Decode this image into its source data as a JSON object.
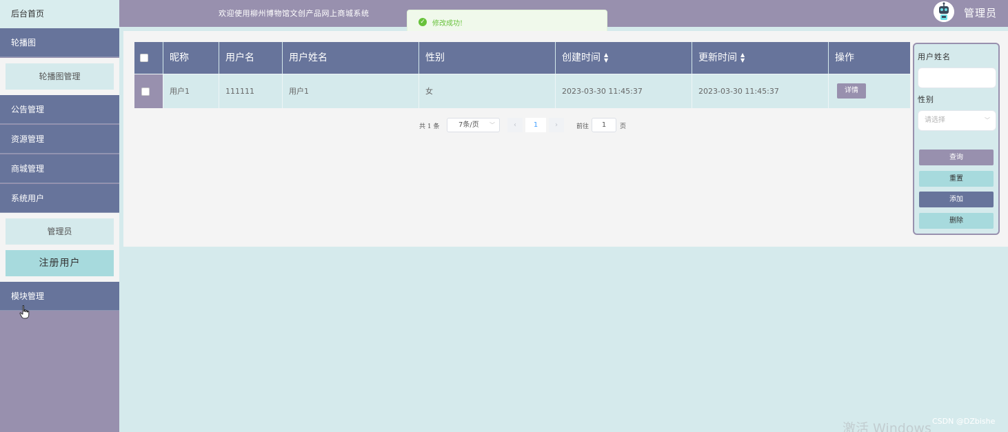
{
  "header": {
    "welcome": "欢迎使用柳州博物馆文创产品网上商城系统",
    "user_label": "管理员"
  },
  "toast": {
    "message": "修改成功!"
  },
  "sidebar": {
    "home": "后台首页",
    "carousel": "轮播图",
    "carousel_manage": "轮播图管理",
    "notice_manage": "公告管理",
    "resource_manage": "资源管理",
    "shop_manage": "商城管理",
    "system_user": "系统用户",
    "admin": "管理员",
    "registered_user": "注册用户",
    "module_manage": "模块管理"
  },
  "table": {
    "headers": {
      "nickname": "昵称",
      "username": "用户名",
      "realname": "用户姓名",
      "gender": "性别",
      "created": "创建时间",
      "updated": "更新时间",
      "actions": "操作"
    },
    "rows": [
      {
        "nickname": "用户1",
        "username": "111111",
        "realname": "用户1",
        "gender": "女",
        "created": "2023-03-30 11:45:37",
        "updated": "2023-03-30 11:45:37",
        "action": "详情"
      }
    ]
  },
  "pagination": {
    "total": "共 1 条",
    "page_size": "7条/页",
    "current": "1",
    "goto_prefix": "前往",
    "goto_value": "1",
    "goto_suffix": "页"
  },
  "search": {
    "name_label": "用户姓名",
    "gender_label": "性别",
    "gender_placeholder": "请选择",
    "query": "查询",
    "reset": "重置",
    "add": "添加",
    "delete": "删除"
  },
  "watermark": {
    "activate": "激活 Windows",
    "csdn": "CSDN @DZbishe"
  },
  "colors": {
    "sidebar_item": "#67749b",
    "header_bg": "#9890ae",
    "content_bg": "#d5eaec",
    "active_sub": "#a7dadd",
    "success": "#67c23a"
  }
}
